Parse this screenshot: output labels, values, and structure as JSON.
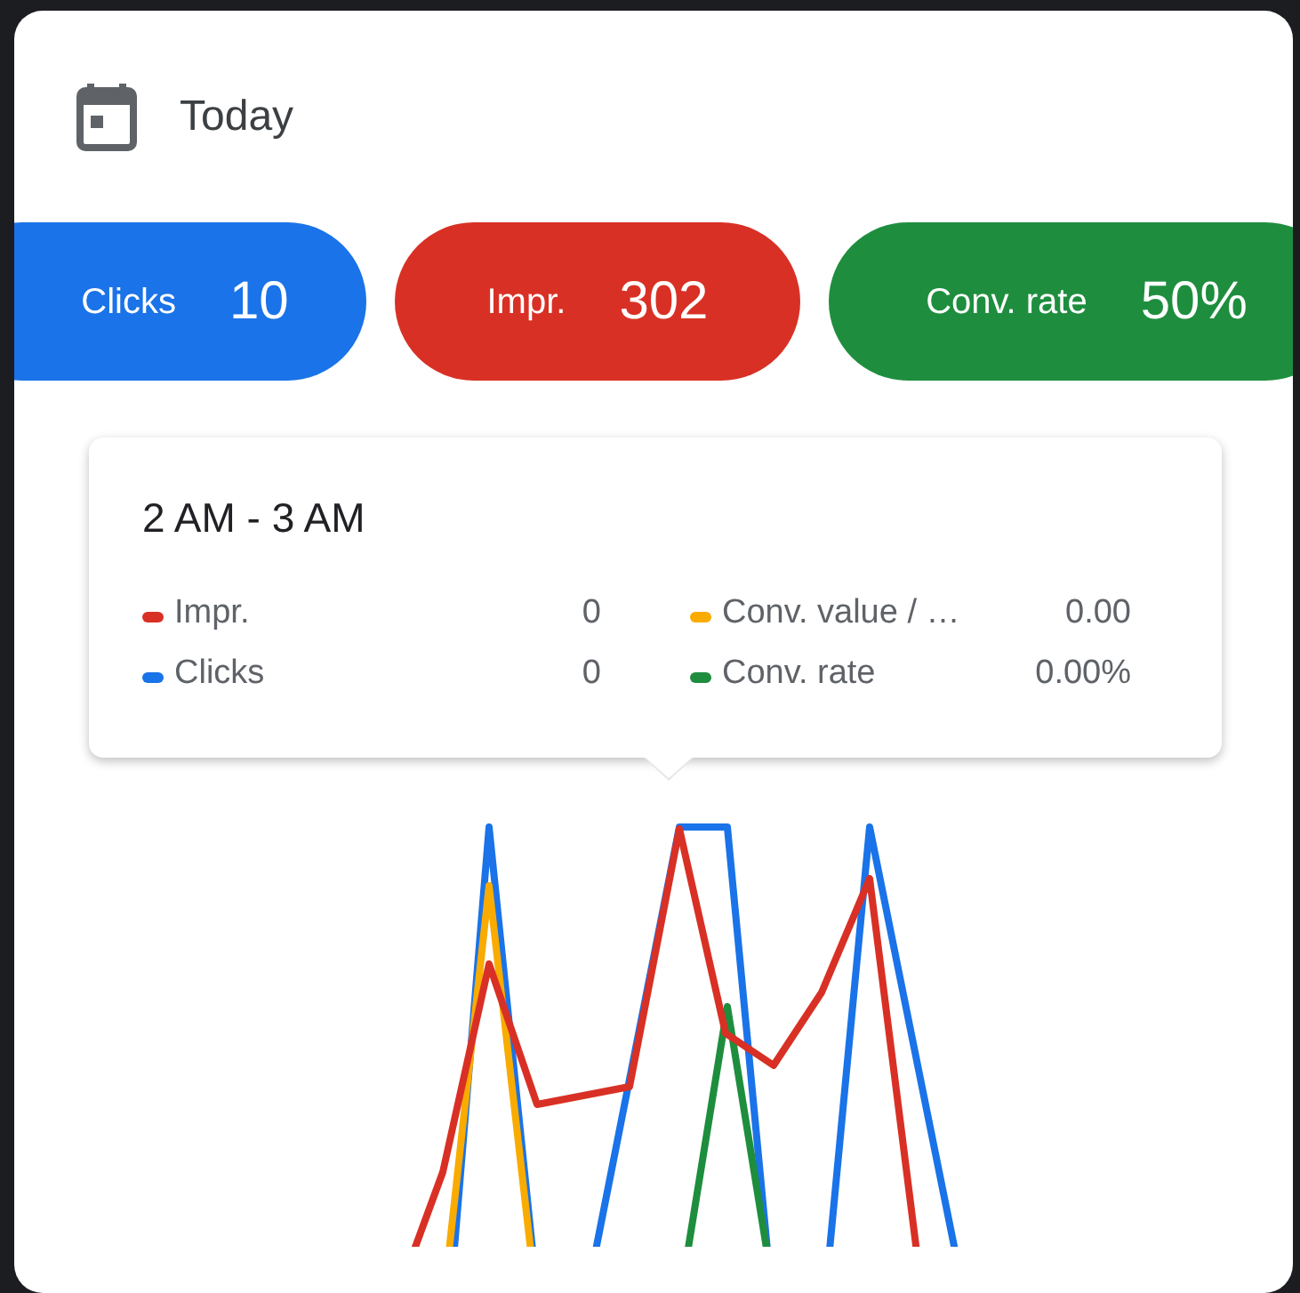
{
  "header": {
    "title": "Today"
  },
  "metrics": [
    {
      "label": "Clicks",
      "value": "10",
      "color": "#1a73e8"
    },
    {
      "label": "Impr.",
      "value": "302",
      "color": "#d93025"
    },
    {
      "label": "Conv. rate",
      "value": "50%",
      "color": "#1e8e3e"
    }
  ],
  "tooltip": {
    "title": "2 AM - 3 AM",
    "items": [
      {
        "label": "Impr.",
        "value": "0",
        "color": "#d93025"
      },
      {
        "label": "Conv. value / …",
        "value": "0.00",
        "color": "#f9ab00"
      },
      {
        "label": "Clicks",
        "value": "0",
        "color": "#1a73e8"
      },
      {
        "label": "Conv. rate",
        "value": "0.00%",
        "color": "#1e8e3e"
      }
    ]
  }
}
